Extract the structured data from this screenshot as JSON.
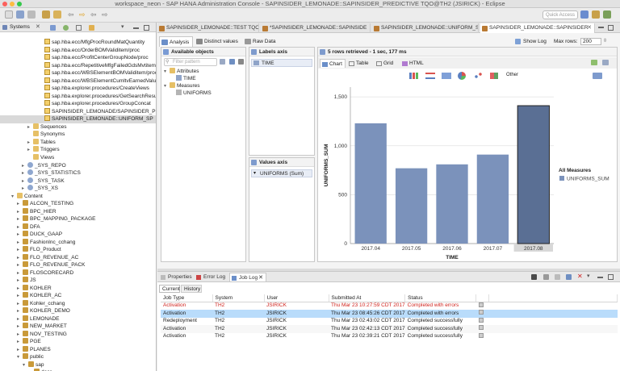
{
  "window": {
    "title": "workspace_neon - SAP HANA Administration Console - SAPINSIDER_LEMONADE::SAPINSIDER_PREDICTIVE TQO@TH2 (JSIRICK) - Eclipse"
  },
  "toolbar": {
    "quick_access": "Quick Access"
  },
  "left_panel": {
    "tab_label": "Systems"
  },
  "tree": [
    {
      "label": "sap.hba.ecc/MfgProcRoundMatQuantity",
      "icon": "proc",
      "indent": 48,
      "top": 48
    },
    {
      "label": "sap.hba.ecc/OrderBOMValiditem/proc",
      "icon": "proc",
      "indent": 48,
      "top": 58
    },
    {
      "label": "sap.hba.ecc/ProfitCenterGroupNode/proc",
      "icon": "proc",
      "indent": 48,
      "top": 67
    },
    {
      "label": "sap.hba.ecc/RepetitiveMfgFailedGdsMvtitemWit",
      "icon": "proc",
      "indent": 48,
      "top": 77
    },
    {
      "label": "sap.hba.ecc/WBSElementBOMValiditem/proc",
      "icon": "proc",
      "indent": 48,
      "top": 86
    },
    {
      "label": "sap.hba.ecc/WBSElementCumltvEarnedValue/pr",
      "icon": "proc",
      "indent": 48,
      "top": 96
    },
    {
      "label": "sap.hba.explorer.procedures/CreateViews",
      "icon": "proc",
      "indent": 48,
      "top": 105
    },
    {
      "label": "sap.hba.explorer.procedures/GetSearchResults",
      "icon": "proc",
      "indent": 48,
      "top": 115
    },
    {
      "label": "sap.hba.explorer.procedures/GroupConcat",
      "icon": "proc",
      "indent": 48,
      "top": 124
    },
    {
      "label": "SAPINSIDER_LEMONADE/SAPINSIDER_PREDICT",
      "icon": "proc",
      "indent": 48,
      "top": 134
    },
    {
      "label": "SAPINSIDER_LEMONADE::UNIFORM_SP",
      "icon": "proc",
      "indent": 48,
      "top": 143,
      "selected": true
    },
    {
      "label": "Sequences",
      "icon": "folder",
      "indent": 34,
      "tw": "▸",
      "top": 153
    },
    {
      "label": "Synonyms",
      "icon": "folder",
      "indent": 34,
      "top": 162
    },
    {
      "label": "Tables",
      "icon": "folder",
      "indent": 34,
      "tw": "▸",
      "top": 172
    },
    {
      "label": "Triggers",
      "icon": "folder",
      "indent": 34,
      "tw": "▸",
      "top": 181
    },
    {
      "label": "Views",
      "icon": "folder",
      "indent": 34,
      "top": 191
    },
    {
      "label": "_SYS_REPO",
      "icon": "db",
      "indent": 27,
      "tw": "▸",
      "top": 201
    },
    {
      "label": "_SYS_STATISTICS",
      "icon": "db",
      "indent": 27,
      "tw": "▸",
      "top": 210
    },
    {
      "label": "_SYS_TASK",
      "icon": "db",
      "indent": 27,
      "tw": "▸",
      "top": 220
    },
    {
      "label": "_SYS_XS",
      "icon": "db",
      "indent": 27,
      "tw": "▸",
      "top": 229
    },
    {
      "label": "Content",
      "icon": "folder",
      "indent": 14,
      "tw": "▾",
      "top": 239
    },
    {
      "label": "ALCON_TESTING",
      "icon": "pkg",
      "indent": 21,
      "tw": "▸",
      "top": 248
    },
    {
      "label": "BPC_HIER",
      "icon": "pkg",
      "indent": 21,
      "tw": "▸",
      "top": 258
    },
    {
      "label": "BPC_MAPPING_PACKAGE",
      "icon": "pkg",
      "indent": 21,
      "tw": "▸",
      "top": 267
    },
    {
      "label": "DFA",
      "icon": "pkg",
      "indent": 21,
      "tw": "▸",
      "top": 277
    },
    {
      "label": "DUCK_GAAP",
      "icon": "pkg",
      "indent": 21,
      "tw": "▸",
      "top": 286
    },
    {
      "label": "FashionInc_cchang",
      "icon": "pkg",
      "indent": 21,
      "tw": "▸",
      "top": 296
    },
    {
      "label": "FLO_Product",
      "icon": "pkg",
      "indent": 21,
      "tw": "▸",
      "top": 305
    },
    {
      "label": "FLO_REVENUE_AC",
      "icon": "pkg",
      "indent": 21,
      "tw": "▸",
      "top": 315
    },
    {
      "label": "FLO_REVENUE_PACK",
      "icon": "pkg",
      "indent": 21,
      "tw": "▸",
      "top": 324
    },
    {
      "label": "FLOSCORECARD",
      "icon": "pkg",
      "indent": 21,
      "tw": "▸",
      "top": 334
    },
    {
      "label": "JS",
      "icon": "pkg",
      "indent": 21,
      "tw": "▸",
      "top": 343
    },
    {
      "label": "KOHLER",
      "icon": "pkg",
      "indent": 21,
      "tw": "▸",
      "top": 353
    },
    {
      "label": "KOHLER_AC",
      "icon": "pkg",
      "indent": 21,
      "tw": "▸",
      "top": 362
    },
    {
      "label": "Kohler_cchang",
      "icon": "pkg",
      "indent": 21,
      "tw": "▸",
      "top": 372
    },
    {
      "label": "KOHLER_DEMO",
      "icon": "pkg",
      "indent": 21,
      "tw": "▸",
      "top": 381
    },
    {
      "label": "LEMONADE",
      "icon": "pkg",
      "indent": 21,
      "tw": "▸",
      "top": 391
    },
    {
      "label": "NEW_MARKET",
      "icon": "pkg",
      "indent": 21,
      "tw": "▸",
      "top": 400
    },
    {
      "label": "NOV_TESTING",
      "icon": "pkg",
      "indent": 21,
      "tw": "▸",
      "top": 410
    },
    {
      "label": "PGE",
      "icon": "pkg",
      "indent": 21,
      "tw": "▸",
      "top": 419
    },
    {
      "label": "PLANES",
      "icon": "pkg",
      "indent": 21,
      "tw": "▸",
      "top": 429
    },
    {
      "label": "public",
      "icon": "pkg",
      "indent": 21,
      "tw": "▾",
      "top": 438
    },
    {
      "label": "sap",
      "icon": "pkg",
      "indent": 28,
      "tw": "▾",
      "top": 448
    },
    {
      "label": "docs",
      "icon": "pkg",
      "indent": 35,
      "tw": "▸",
      "top": 457
    }
  ],
  "editor_tabs": [
    {
      "label": "SAPINSIDER_LEMONADE::TEST TQO@"
    },
    {
      "label": "*SAPINSIDER_LEMONADE::SAPINSIDE"
    },
    {
      "label": "SAPINSIDER_LEMONADE::UNIFORM_S"
    },
    {
      "label": "SAPINSIDER_LEMONADE::SAPINSIDER",
      "active": true
    }
  ],
  "analysis_tabs": [
    {
      "label": "Analysis",
      "active": true
    },
    {
      "label": "Distinct values"
    },
    {
      "label": "Raw Data"
    }
  ],
  "show_log": "Show Log",
  "max_rows_label": "Max rows:",
  "max_rows_value": "200",
  "available_objects": {
    "title": "Available objects",
    "filter_placeholder": "Filter pattern",
    "attributes_label": "Attributes",
    "attributes": [
      "TIME"
    ],
    "measures_label": "Measures",
    "measures": [
      "UNIFORMS"
    ]
  },
  "labels_axis": {
    "title": "Labels axis",
    "items": [
      "TIME"
    ]
  },
  "values_axis": {
    "title": "Values axis",
    "items": [
      "UNIFORMS (Sum)"
    ]
  },
  "result_status": "5 rows retrieved - 1 sec, 177 ms",
  "chart_tabs": [
    {
      "label": "Chart",
      "active": true
    },
    {
      "label": "Table"
    },
    {
      "label": "Grid"
    },
    {
      "label": "HTML"
    }
  ],
  "chart_toolbar": {
    "other_label": "Other"
  },
  "chart_data": {
    "type": "bar",
    "categories": [
      "2017.04",
      "2017.05",
      "2017.06",
      "2017.07",
      "2017.08"
    ],
    "values": [
      1230,
      770,
      810,
      910,
      1410
    ],
    "xlabel": "TIME",
    "ylabel": "UNIFORMS_SUM",
    "yticks": [
      0,
      500,
      1000,
      1500
    ],
    "ytick_labels": [
      "0",
      "500",
      "1,000",
      "1,500"
    ],
    "ylim": [
      0,
      1600
    ],
    "selected_index": 4,
    "legend_title": "All Measures",
    "legend_items": [
      "UNIFORMS_SUM"
    ],
    "bar_color": "#7b92bb",
    "selected_bar_color": "#5a6f94"
  },
  "bottom_tabs": [
    {
      "label": "Properties"
    },
    {
      "label": "Error Log"
    },
    {
      "label": "Job Log",
      "active": true
    }
  ],
  "job_log": {
    "subtabs": [
      {
        "label": "Current",
        "active": true
      },
      {
        "label": "History"
      }
    ],
    "columns": [
      "Job Type",
      "System",
      "User",
      "Submitted At",
      "Status"
    ],
    "rows": [
      {
        "job_type": "Activation",
        "system": "TH2",
        "user": "JSIRICK",
        "submitted": "Thu Mar 23 10:27:59 CDT 2017",
        "status": "Completed with errors",
        "error": true
      },
      {
        "job_type": "Activation",
        "system": "TH2",
        "user": "JSIRICK",
        "submitted": "Thu Mar 23 08:45:26 CDT 2017",
        "status": "Completed with errors",
        "highlight": true
      },
      {
        "job_type": "Redeployment",
        "system": "TH2",
        "user": "JSIRICK",
        "submitted": "Thu Mar 23 02:43:02 CDT 2017",
        "status": "Completed successfully"
      },
      {
        "job_type": "Activation",
        "system": "TH2",
        "user": "JSIRICK",
        "submitted": "Thu Mar 23 02:42:13 CDT 2017",
        "status": "Completed successfully"
      },
      {
        "job_type": "Activation",
        "system": "TH2",
        "user": "JSIRICK",
        "submitted": "Thu Mar 23 02:39:21 CDT 2017",
        "status": "Completed successfully"
      }
    ]
  }
}
